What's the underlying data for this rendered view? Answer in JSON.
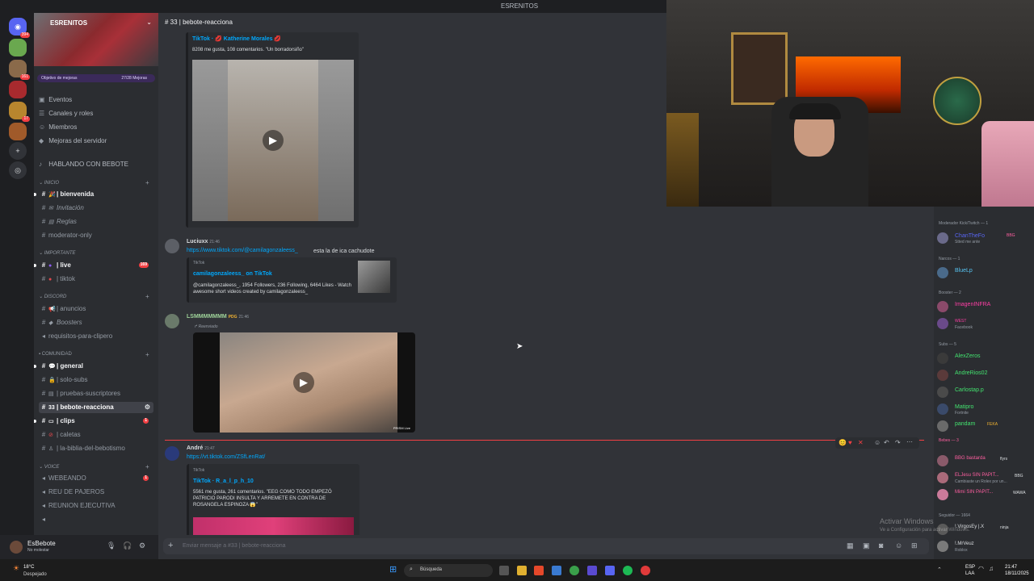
{
  "window": {
    "title": "ESRENITOS"
  },
  "server": {
    "name": "ESRENITOS",
    "boost": {
      "label": "Objetivo de mejoras",
      "count": "27/28 Mejoras"
    },
    "nav": [
      "Eventos",
      "Canales y roles",
      "Miembros",
      "Mejoras del servidor"
    ],
    "top_channel": "HABLANDO CON BEBOTE",
    "rail_badges": {
      "home": "394",
      "s2": "161",
      "s3": "17"
    }
  },
  "categories": {
    "inicio": "INICIO",
    "importante": "IMPORTANTE",
    "discord": "DISCORD",
    "comunidad": "COMUNIDAD",
    "voice": "VOICE"
  },
  "channels": {
    "bienvenida": "| bienvenida",
    "invitacion": "Invitación",
    "reglas": "Reglas",
    "moderator": "moderator-only",
    "live": "| live",
    "live_count": "169",
    "tiktok": "| tiktok",
    "anuncios": "| anuncios",
    "boosters": "Boosters",
    "requisitos": "requisitos-para-clipero",
    "general": "| general",
    "solo_subs": "| solo-subs",
    "pruebas": "| pruebas-suscriptores",
    "bebote": "| bebote-reacciona",
    "clips": "| clips",
    "clips_count": "1",
    "caletas": "| caletas",
    "biblia": "| la-biblia-del-bebotismo",
    "webeando": "WEBEANDO",
    "webeando_count": "1",
    "reu": "REU DE PAJEROS",
    "reunion": "REUNION EJECUTIVA"
  },
  "user": {
    "name": "EsBebote",
    "status": "No molestar"
  },
  "chat": {
    "header": "| bebote-reacciona",
    "msg0": {
      "embed_title": "TikTok · 💋 Katherine Morales 💋",
      "embed_desc": "8208 me gusta, 108 comentarios. \"Un borradorsiño\""
    },
    "msg1": {
      "author": "Luciuxx",
      "time": "21:46",
      "link": "https://www.tiktok.com/@camilagonzaleess_",
      "text": "esta la de ica cachudote",
      "embed_provider": "TikTok",
      "embed_title": "camilagonzaleess_ on TikTok",
      "embed_desc": "@camilagonzaleess_, 1954 Followers, 236 Following, 6464 Likes - Watch awesome short videos created by camilagonzaleess_"
    },
    "msg2": {
      "author": "LSMMMMMMM",
      "tag": "PDG",
      "time": "21:46",
      "forwarded": "Reenviado",
      "video_watermark": "PRISM Live"
    },
    "msg3": {
      "author": "André",
      "time": "21:47",
      "link": "https://vt.tiktok.com/ZSfLenRat/",
      "embed_provider": "TikTok",
      "embed_title": "TikTok · R_a_l_p_h_10",
      "embed_desc": "5561 me gusta, 261 comentarios. \"EEG COMO TODO EMPEZÓ PATRICIO PARODI INSULTA Y ARREMETE EN CONTRA DE ROSANGELA ESPINOZA 😱\""
    },
    "input_placeholder": "Enviar mensaje a #33 | bebote-reacciona"
  },
  "members": {
    "groups": [
      {
        "label": "Moderador Kick/Twitch — 1"
      },
      {
        "label": "Narcos — 1"
      },
      {
        "label": "Booster — 2"
      },
      {
        "label": "Subs — 5"
      },
      {
        "label": "Bebes — 3"
      },
      {
        "label": "Seguidor — 1664"
      }
    ],
    "list": [
      {
        "name": "ChanTheFo",
        "sub": "Stted me ante",
        "color": "#5865f2",
        "tag": "BBG"
      },
      {
        "name": "BlueLp",
        "sub": "",
        "color": "#57c4f2",
        "tag": ""
      },
      {
        "name": "ImagenINFRA",
        "sub": "",
        "color": "#ff3ea5",
        "tag": ""
      },
      {
        "name": "WEST",
        "sub": "Facebook",
        "color": "#ff3ea5",
        "tag": ""
      },
      {
        "name": "AlexZeros",
        "sub": "",
        "color": "#43e26f",
        "tag": ""
      },
      {
        "name": "AndreRios02",
        "sub": "",
        "color": "#43e26f",
        "tag": ""
      },
      {
        "name": "Carlostap.p",
        "sub": "",
        "color": "#43e26f",
        "tag": ""
      },
      {
        "name": "Matipro",
        "sub": "Fortnite",
        "color": "#43e26f",
        "tag": ""
      },
      {
        "name": "pandam",
        "sub": "",
        "color": "#43e26f",
        "tag": "FEKA"
      },
      {
        "name": "BBG bastarda",
        "sub": "",
        "color": "#ff5fa0",
        "tag": "flyrs"
      },
      {
        "name": "ELJesu SIN PAPIT...",
        "sub": "Cambiaste un Rolex por un...",
        "color": "#ff5fa0",
        "tag": "BBG"
      },
      {
        "name": "Mimi SIN PAPIT...",
        "sub": "",
        "color": "#ff5fa0",
        "tag": "WAWA"
      },
      {
        "name": "!.VirgosEy |.X",
        "sub": "",
        "color": "#dbdee1",
        "tag": "ninja"
      },
      {
        "name": "!.MrVeuz",
        "sub": "Roblox",
        "color": "#dbdee1",
        "tag": ""
      }
    ]
  },
  "overlay": {
    "line1": "Activar Windows",
    "line2": "Ve a Configuración para activar Windows."
  },
  "taskbar": {
    "weather_temp": "18°C",
    "weather_desc": "Despejado",
    "search": "Búsqueda",
    "lang": "ESP",
    "lang2": "LAA",
    "time": "21:47",
    "date": "18/11/2025"
  }
}
